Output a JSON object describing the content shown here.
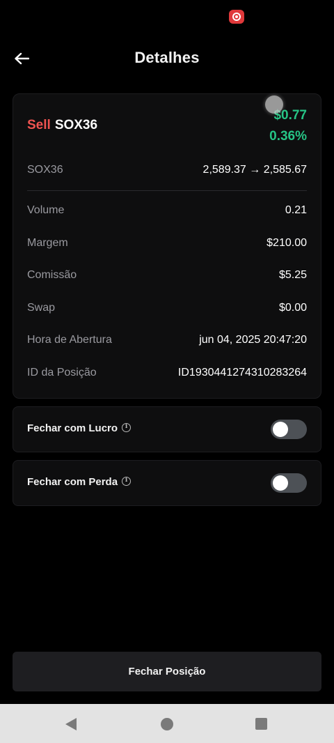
{
  "status_bar": {
    "recording_icon": "screen-record-icon",
    "record_color": "#e0393b"
  },
  "header": {
    "title": "Detalhes",
    "back_icon": "arrow-left-icon"
  },
  "position": {
    "side": "Sell",
    "symbol": "SOX36",
    "pnl_value": "$0.77",
    "pnl_percent": "0.36%",
    "side_color": "#ef5350",
    "pnl_color": "#26c485",
    "price_label": "SOX36",
    "price_value": "2,589.37 → 2,585.67"
  },
  "details": [
    {
      "label": "Volume",
      "value": "0.21"
    },
    {
      "label": "Margem",
      "value": "$210.00"
    },
    {
      "label": "Comissão",
      "value": "$5.25"
    },
    {
      "label": "Swap",
      "value": "$0.00"
    },
    {
      "label": "Hora de Abertura",
      "value": "jun 04, 2025 20:47:20"
    },
    {
      "label": "ID da Posição",
      "value": "ID1930441274310283264"
    }
  ],
  "take_profit": {
    "label": "Fechar com Lucro",
    "enabled": false,
    "icon": "info-icon"
  },
  "stop_loss": {
    "label": "Fechar com Perda",
    "enabled": false,
    "icon": "info-icon"
  },
  "actions": {
    "close_label": "Fechar Posição"
  },
  "nav_bar": {
    "back_icon": "nav-back-icon",
    "home_icon": "nav-home-icon",
    "recents_icon": "nav-recents-icon"
  }
}
